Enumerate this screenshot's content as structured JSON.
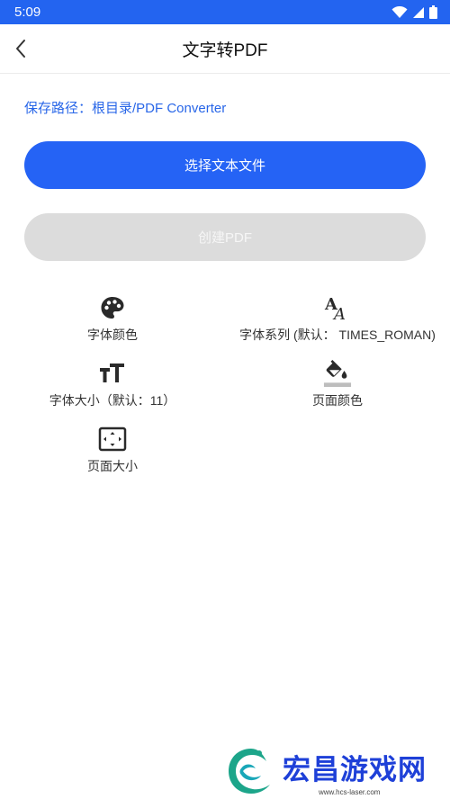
{
  "status_bar": {
    "time": "5:09"
  },
  "header": {
    "title": "文字转PDF"
  },
  "save_path": {
    "text": "保存路径：根目录/PDF Converter"
  },
  "buttons": {
    "select_text_file": "选择文本文件",
    "create_pdf": "创建PDF"
  },
  "options": [
    {
      "label": "字体颜色",
      "icon": "palette-icon"
    },
    {
      "label": "字体系列 (默认： TIMES_ROMAN)",
      "icon": "font-family-icon"
    },
    {
      "label": "字体大小（默认：11）",
      "icon": "font-size-icon"
    },
    {
      "label": "页面颜色",
      "icon": "fill-color-icon"
    },
    {
      "label": "页面大小",
      "icon": "page-size-icon"
    }
  ],
  "watermark": {
    "text": "宏昌游戏网",
    "url": "www.hcs-laser.com"
  },
  "colors": {
    "status_bar": "#2364f0",
    "primary_button": "#2563f5",
    "disabled_button": "#dcdcdc",
    "link_text": "#2866e8",
    "watermark": "#1e40d8"
  }
}
